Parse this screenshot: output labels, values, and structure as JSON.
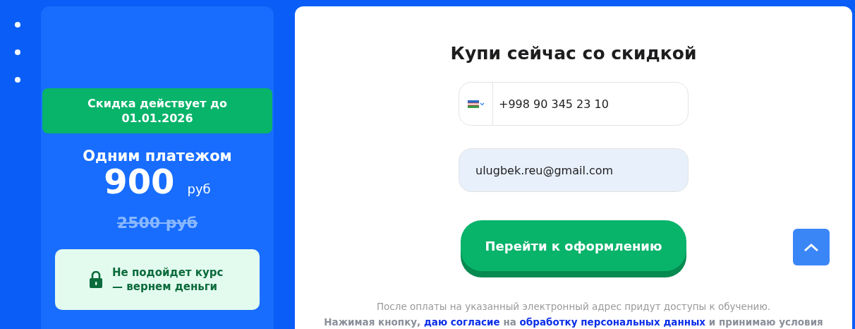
{
  "carousel_dots": [
    {
      "selected": false
    },
    {
      "selected": false
    },
    {
      "selected": false
    }
  ],
  "offer": {
    "discount_badge": "Скидка действует до 01.01.2026",
    "payment_label": "Одним платежом",
    "price": "900",
    "currency": "руб",
    "old_price": "2500 руб",
    "guarantee": "Не подойдет курс — вернем деньги"
  },
  "form": {
    "title": "Купи сейчас со скидкой",
    "phone": {
      "value": "+998 90 345 23 10"
    },
    "email": {
      "value": "ulugbek.reu@gmail.com",
      "autofilled": true
    },
    "submit": "Перейти к оформлению",
    "note": "После оплаты на указанный электронный адрес придут доступы к обучению.",
    "consent": [
      {
        "kind": "text",
        "text": "Нажимая кнопку, "
      },
      {
        "kind": "link",
        "text": "даю согласие"
      },
      {
        "kind": "text",
        "text": " на "
      },
      {
        "kind": "link",
        "text": "обработку персональных данных"
      },
      {
        "kind": "text",
        "text": " и принимаю условия"
      }
    ]
  }
}
